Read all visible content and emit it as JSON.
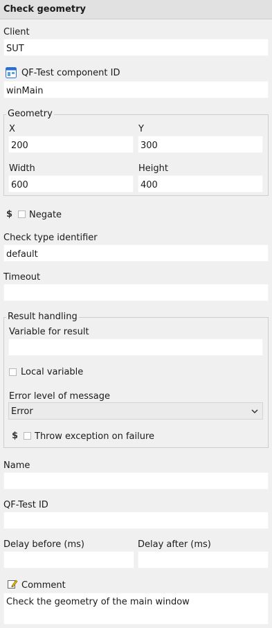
{
  "header": {
    "title": "Check geometry"
  },
  "client": {
    "label": "Client",
    "value": "SUT"
  },
  "component": {
    "label": "QF-Test component ID",
    "value": "winMain",
    "icon": "window-component-icon"
  },
  "geometry": {
    "legend": "Geometry",
    "x_label": "X",
    "x_value": "200",
    "y_label": "Y",
    "y_value": "300",
    "width_label": "Width",
    "width_value": "600",
    "height_label": "Height",
    "height_value": "400"
  },
  "negate": {
    "dollar": "$",
    "label": "Negate",
    "checked": false
  },
  "check_type": {
    "label": "Check type identifier",
    "value": "default"
  },
  "timeout": {
    "label": "Timeout",
    "value": ""
  },
  "result_handling": {
    "legend": "Result handling",
    "variable_label": "Variable for result",
    "variable_value": "",
    "local_label": "Local variable",
    "local_checked": false,
    "error_level_label": "Error level of message",
    "error_level_value": "Error",
    "throw_dollar": "$",
    "throw_label": "Throw exception on failure",
    "throw_checked": false
  },
  "name": {
    "label": "Name",
    "value": ""
  },
  "qftest_id": {
    "label": "QF-Test ID",
    "value": ""
  },
  "delay_before": {
    "label": "Delay before (ms)",
    "value": ""
  },
  "delay_after": {
    "label": "Delay after (ms)",
    "value": ""
  },
  "comment": {
    "label": "Comment",
    "value": "Check the geometry of the main window",
    "icon": "pencil-note-icon"
  }
}
